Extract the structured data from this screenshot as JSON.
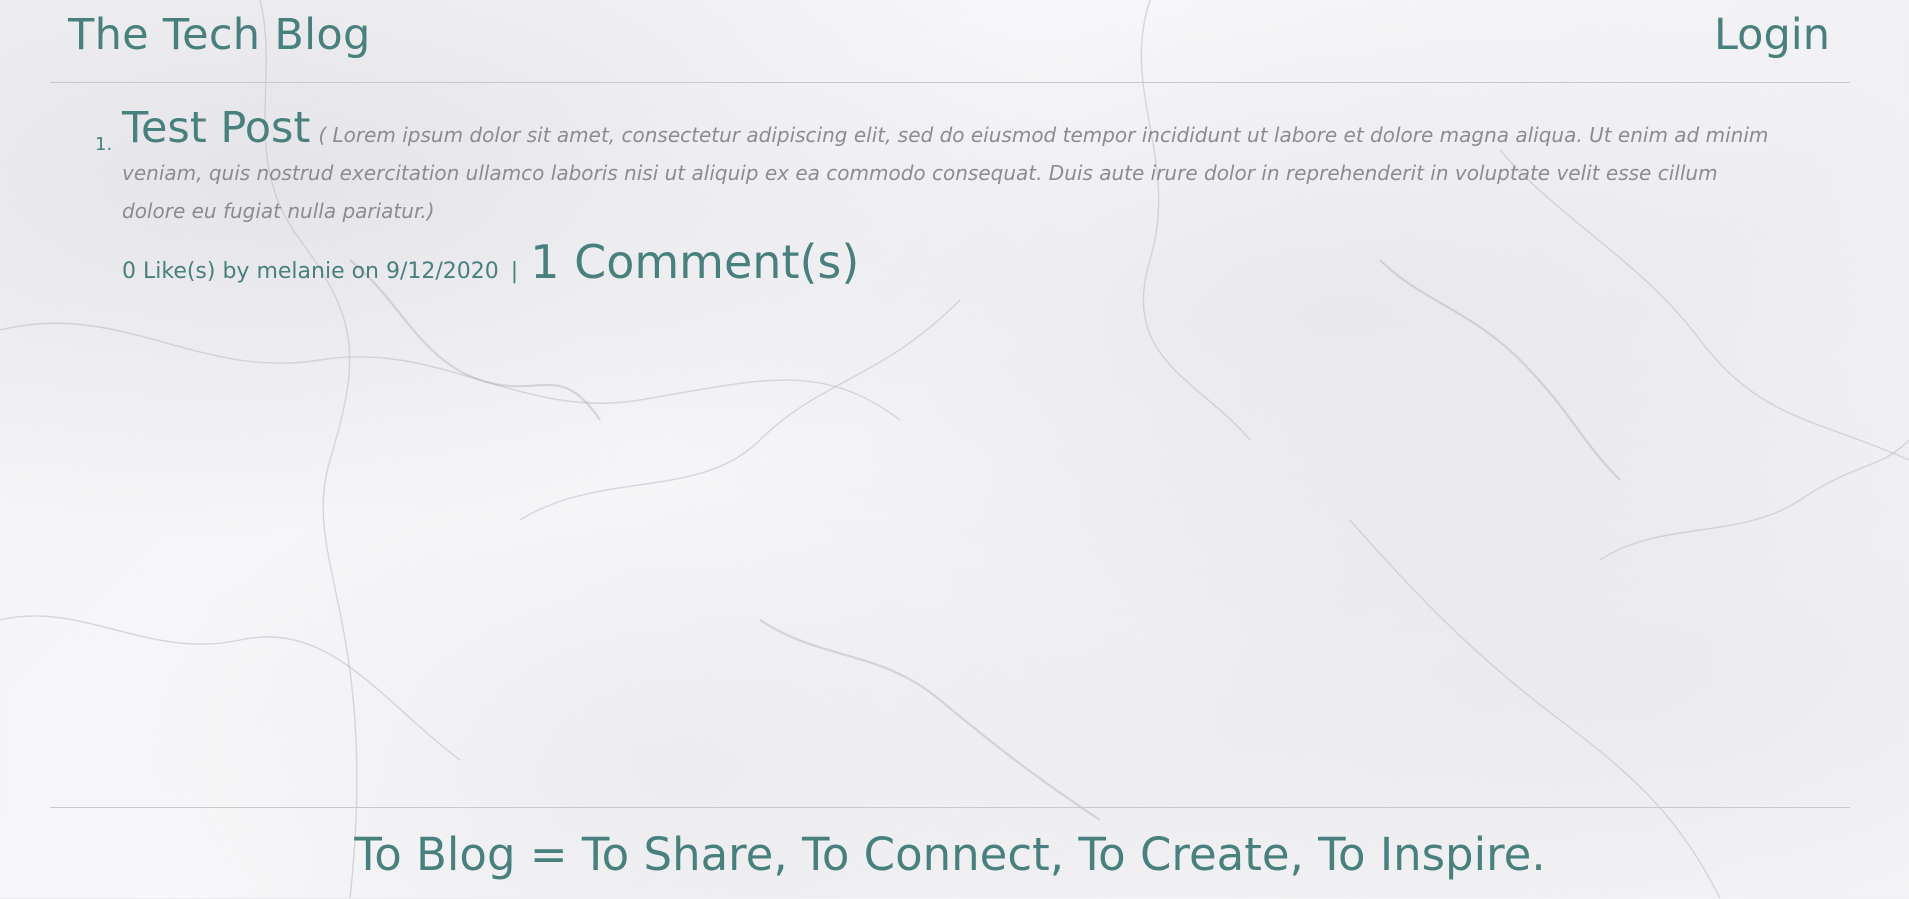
{
  "header": {
    "site_title": "The Tech Blog",
    "login_label": "Login"
  },
  "posts": [
    {
      "number": "1.",
      "title": "Test Post",
      "excerpt": "( Lorem ipsum dolor sit amet, consectetur adipiscing elit, sed do eiusmod tempor incididunt ut labore et dolore magna aliqua. Ut enim ad minim veniam, quis nostrud exercitation ullamco laboris nisi ut aliquip ex ea commodo consequat. Duis aute irure dolor in reprehenderit in voluptate velit esse cillum dolore eu fugiat nulla pariatur.)",
      "meta": "0 Like(s) by melanie on 9/12/2020",
      "separator": "|",
      "comments": "1 Comment(s)"
    }
  ],
  "footer": {
    "tagline": "To Blog = To Share, To Connect, To Create, To Inspire."
  },
  "colors": {
    "accent": "#47807c",
    "excerpt": "#8b8b91",
    "divider": "#c9c9cc"
  }
}
